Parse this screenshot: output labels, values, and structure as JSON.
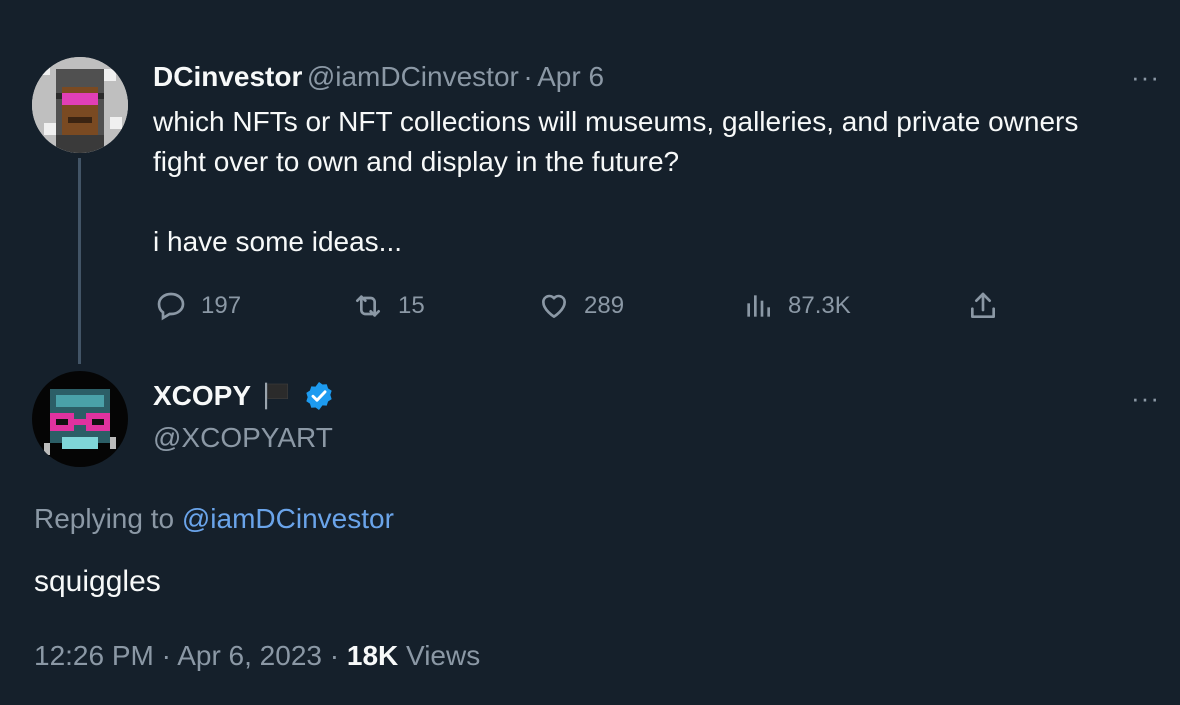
{
  "original_tweet": {
    "display_name": "DCinvestor",
    "handle": "@iamDCinvestor",
    "separator": "·",
    "date": "Apr 6",
    "text": "which NFTs or NFT collections will museums, galleries, and private owners fight over to own and display in the future?\n\ni have some ideas...",
    "more": "···",
    "actions": {
      "replies": "197",
      "retweets": "15",
      "likes": "289",
      "views": "87.3K"
    }
  },
  "reply_tweet": {
    "display_name": "XCOPY",
    "handle": "@XCOPYART",
    "more": "···",
    "replying_prefix": "Replying to",
    "replying_handle": "@iamDCinvestor",
    "text": "squiggles",
    "time": "12:26 PM",
    "separator": "·",
    "date": "Apr 6, 2023",
    "separator2": "·",
    "views_count": "18K",
    "views_label": "Views"
  },
  "icons": {
    "reply": "speech-bubble-icon",
    "retweet": "retweet-icon",
    "like": "heart-icon",
    "views": "bar-chart-icon",
    "share": "share-icon",
    "verified": "verified-badge-icon",
    "flag": "black-flag-icon"
  },
  "colors": {
    "background": "#15202b",
    "text": "#f7f9f9",
    "muted": "#8b98a5",
    "link": "#6aa4ea",
    "verified": "#1d9bf0"
  }
}
